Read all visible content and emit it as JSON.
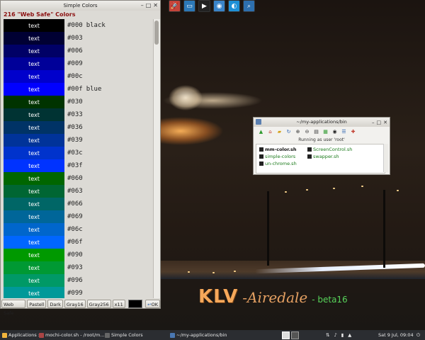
{
  "simple_colors": {
    "title": "Simple Colors",
    "heading": "216 \"Web Safe\" Colors",
    "swatch_text": "text",
    "rows": [
      {
        "code": "#000",
        "name": "black",
        "color": "#000000"
      },
      {
        "code": "#003",
        "name": "",
        "color": "#000033"
      },
      {
        "code": "#006",
        "name": "",
        "color": "#000066"
      },
      {
        "code": "#009",
        "name": "",
        "color": "#000099"
      },
      {
        "code": "#00c",
        "name": "",
        "color": "#0000cc"
      },
      {
        "code": "#00f",
        "name": "blue",
        "color": "#0000ff"
      },
      {
        "code": "#030",
        "name": "",
        "color": "#003300"
      },
      {
        "code": "#033",
        "name": "",
        "color": "#003333"
      },
      {
        "code": "#036",
        "name": "",
        "color": "#003366"
      },
      {
        "code": "#039",
        "name": "",
        "color": "#003399"
      },
      {
        "code": "#03c",
        "name": "",
        "color": "#0033cc"
      },
      {
        "code": "#03f",
        "name": "",
        "color": "#0033ff"
      },
      {
        "code": "#060",
        "name": "",
        "color": "#006600"
      },
      {
        "code": "#063",
        "name": "",
        "color": "#006633"
      },
      {
        "code": "#066",
        "name": "",
        "color": "#006666"
      },
      {
        "code": "#069",
        "name": "",
        "color": "#006699"
      },
      {
        "code": "#06c",
        "name": "",
        "color": "#0066cc"
      },
      {
        "code": "#06f",
        "name": "",
        "color": "#0066ff"
      },
      {
        "code": "#090",
        "name": "",
        "color": "#009900"
      },
      {
        "code": "#093",
        "name": "",
        "color": "#009933"
      },
      {
        "code": "#096",
        "name": "",
        "color": "#009966"
      },
      {
        "code": "#099",
        "name": "",
        "color": "#009999"
      }
    ],
    "buttons": {
      "web_safe": "Web Safe",
      "pastell": "Pastell",
      "dark": "Dark",
      "gray16": "Gray16",
      "gray256": "Gray256",
      "x11": "x11",
      "ok": "OK"
    }
  },
  "file_manager": {
    "title": "~/my-applications/bin",
    "status": "Running as user 'root'",
    "files": [
      {
        "name": "mm-color.sh",
        "bold": true
      },
      {
        "name": "ScreenControl.sh",
        "bold": false
      },
      {
        "name": "simple-colors",
        "bold": false
      },
      {
        "name": "swapper.sh",
        "bold": false
      },
      {
        "name": "un-chrome.sh",
        "bold": false
      }
    ]
  },
  "brand": {
    "klv": "KLV",
    "airedale": "-Airedale",
    "beta": "- beta16"
  },
  "taskbar": {
    "applications": "Applications :",
    "task1": "mochi-color.sh - /root/m...",
    "task2": "Simple Colors",
    "task3": "~/my-applications/bin",
    "clock": "Sat  9 Jul, 09:04"
  },
  "icons": {
    "launcher": [
      "rocket-icon",
      "window-icon",
      "terminal-icon",
      "disk-icon",
      "web-browser-icon",
      "search-icon"
    ],
    "file_toolbar": [
      "up-arrow-icon",
      "home-icon",
      "folder-icon",
      "refresh-icon",
      "zoom-in-icon",
      "zoom-out-icon",
      "list-view-icon",
      "icons-view-icon",
      "show-hidden-icon",
      "details-view-icon",
      "settings-icon"
    ],
    "tray": [
      "network-icon",
      "volume-icon",
      "battery-icon",
      "notification-icon",
      "power-icon"
    ]
  },
  "colors": {
    "heading_red": "#8b1010",
    "file_green": "#1a7a1a",
    "brand_orange": "#f6a85a",
    "beta_green": "#57d35a",
    "taskbar_bg": "#2b2d31"
  }
}
